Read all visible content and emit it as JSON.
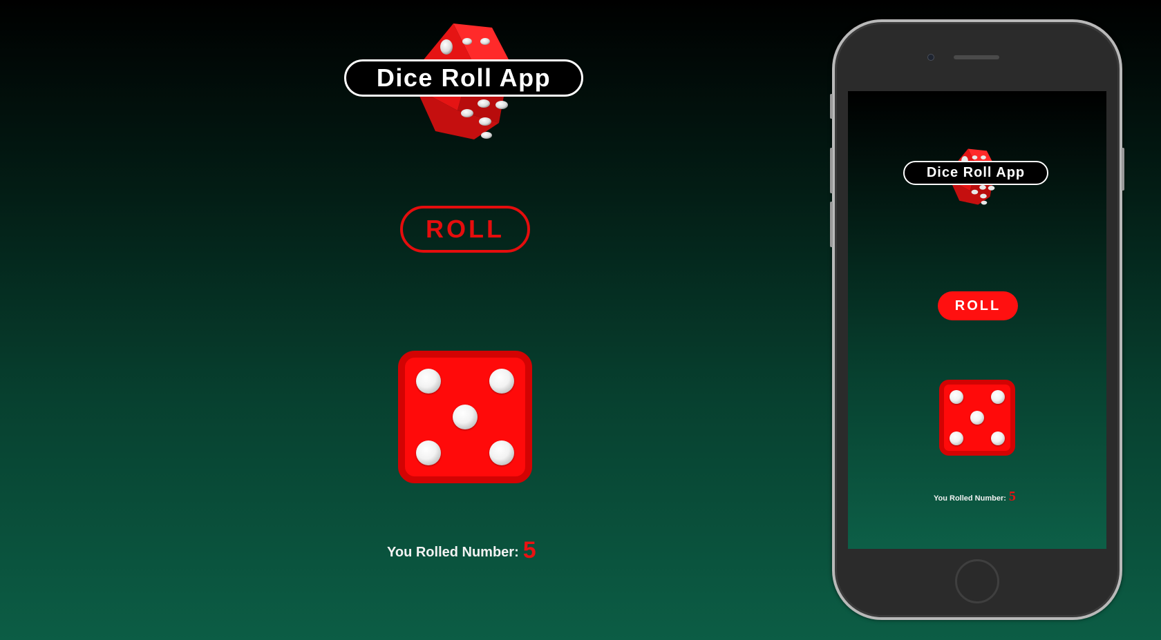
{
  "app": {
    "title": "Dice Roll App",
    "roll_label": "ROLL",
    "result_label": "You Rolled Number:",
    "rolled_value": "5",
    "die_face": 5
  },
  "phone_screen": {
    "title": "Dice Roll App",
    "roll_label": "ROLL",
    "result_label": "You Rolled Number:",
    "rolled_value": "5"
  },
  "icons": {
    "logo": "red-3d-dice-icon",
    "die": "dice-five-icon"
  },
  "colors": {
    "accent_red": "#e50d0d",
    "die_red": "#ff0a0a",
    "die_border": "#d30303",
    "bg_top": "#000000",
    "bg_bottom": "#0c5d45"
  }
}
